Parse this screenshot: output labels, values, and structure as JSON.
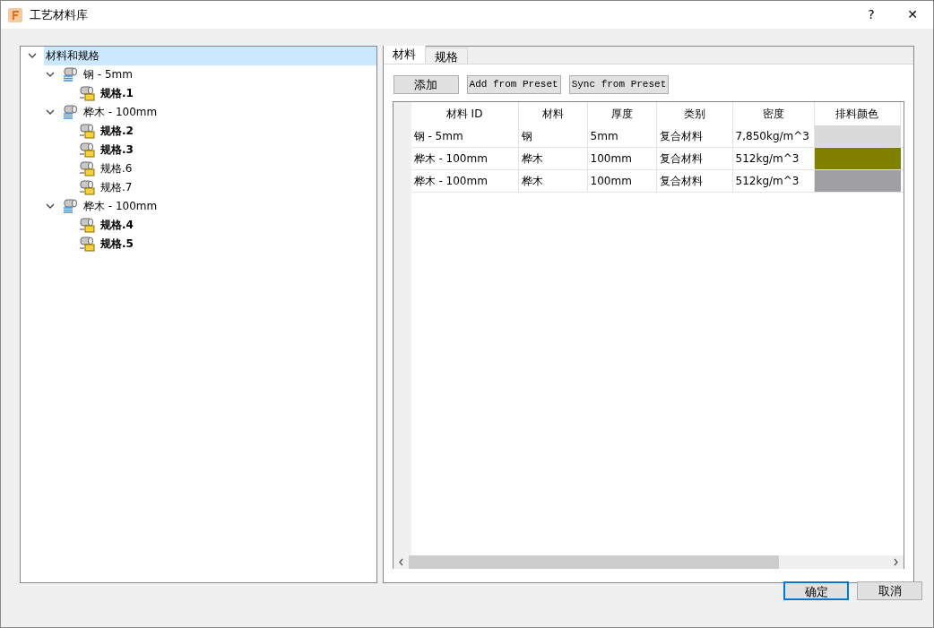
{
  "window": {
    "title": "工艺材料库",
    "buttons": [
      "?",
      "✕"
    ]
  },
  "tree": {
    "label": "材料和规格",
    "selected": true,
    "expanded": true,
    "kind": "root",
    "children": [
      {
        "label": "钢 - 5mm",
        "kind": "material",
        "expanded": true,
        "selected": false,
        "children": [
          {
            "label": "规格.1",
            "kind": "spec",
            "bold": true,
            "selected": false
          }
        ]
      },
      {
        "label": "桦木 - 100mm",
        "kind": "material",
        "expanded": true,
        "selected": false,
        "children": [
          {
            "label": "规格.2",
            "kind": "spec",
            "bold": true,
            "selected": false
          },
          {
            "label": "规格.3",
            "kind": "spec",
            "bold": true,
            "selected": false
          },
          {
            "label": "规格.6",
            "kind": "spec",
            "bold": false,
            "selected": false
          },
          {
            "label": "规格.7",
            "kind": "spec",
            "bold": false,
            "selected": false
          }
        ]
      },
      {
        "label": "桦木 - 100mm",
        "kind": "material",
        "expanded": true,
        "selected": false,
        "children": [
          {
            "label": "规格.4",
            "kind": "spec",
            "bold": true,
            "selected": false
          },
          {
            "label": "规格.5",
            "kind": "spec",
            "bold": true,
            "selected": false
          }
        ]
      }
    ]
  },
  "tabs": [
    {
      "label": "材料",
      "selected": true
    },
    {
      "label": "规格",
      "selected": false
    }
  ],
  "toolbar": [
    "添加",
    "Add from Preset",
    "Sync from Preset"
  ],
  "table": {
    "columns": [
      "材料 ID",
      "材料",
      "厚度",
      "类别",
      "密度",
      "排料颜色"
    ],
    "rows": [
      {
        "cells": [
          "钢 - 5mm",
          "钢",
          "5mm",
          "复合材料",
          "7,850kg/m^3"
        ],
        "color": "#dadada"
      },
      {
        "cells": [
          "桦木 - 100mm",
          "桦木",
          "100mm",
          "复合材料",
          "512kg/m^3"
        ],
        "color": "#808000"
      },
      {
        "cells": [
          "桦木 - 100mm",
          "桦木",
          "100mm",
          "复合材料",
          "512kg/m^3"
        ],
        "color": "#a0a0a4"
      }
    ]
  },
  "footer": {
    "buttons": [
      {
        "label": "确定",
        "selected": true
      },
      {
        "label": "取消",
        "selected": false
      }
    ]
  }
}
